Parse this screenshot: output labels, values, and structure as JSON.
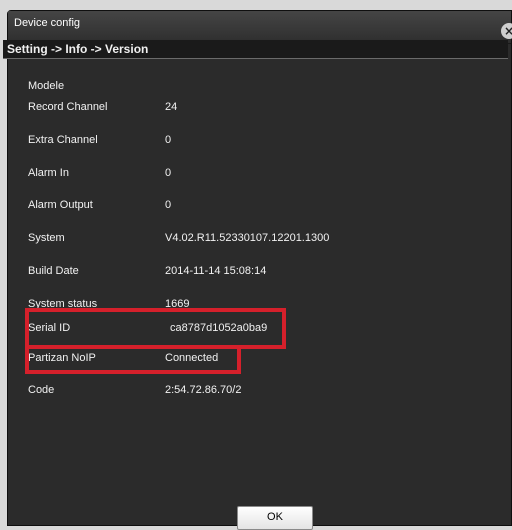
{
  "window": {
    "title": "Device config"
  },
  "breadcrumb": "Setting -> Info -> Version",
  "section": "Modele",
  "rows": [
    {
      "label": "Record Channel",
      "value": "24"
    },
    {
      "label": "Extra Channel",
      "value": "0"
    },
    {
      "label": "Alarm In",
      "value": "0"
    },
    {
      "label": "Alarm Output",
      "value": "0"
    },
    {
      "label": "System",
      "value": "V4.02.R11.52330107.12201.1300"
    },
    {
      "label": "Build Date",
      "value": "2014-11-14 15:08:14"
    },
    {
      "label": "System status",
      "value": "1669"
    },
    {
      "label": "Serial ID",
      "value": "ca8787d1052a0ba9"
    },
    {
      "label": "Partizan NoIP",
      "value": "Connected"
    },
    {
      "label": "Code",
      "value": "2:54.72.86.70/2"
    }
  ],
  "buttons": {
    "ok": "OK"
  },
  "colors": {
    "highlight": "#d5202b",
    "background": "#2b2b2b"
  }
}
